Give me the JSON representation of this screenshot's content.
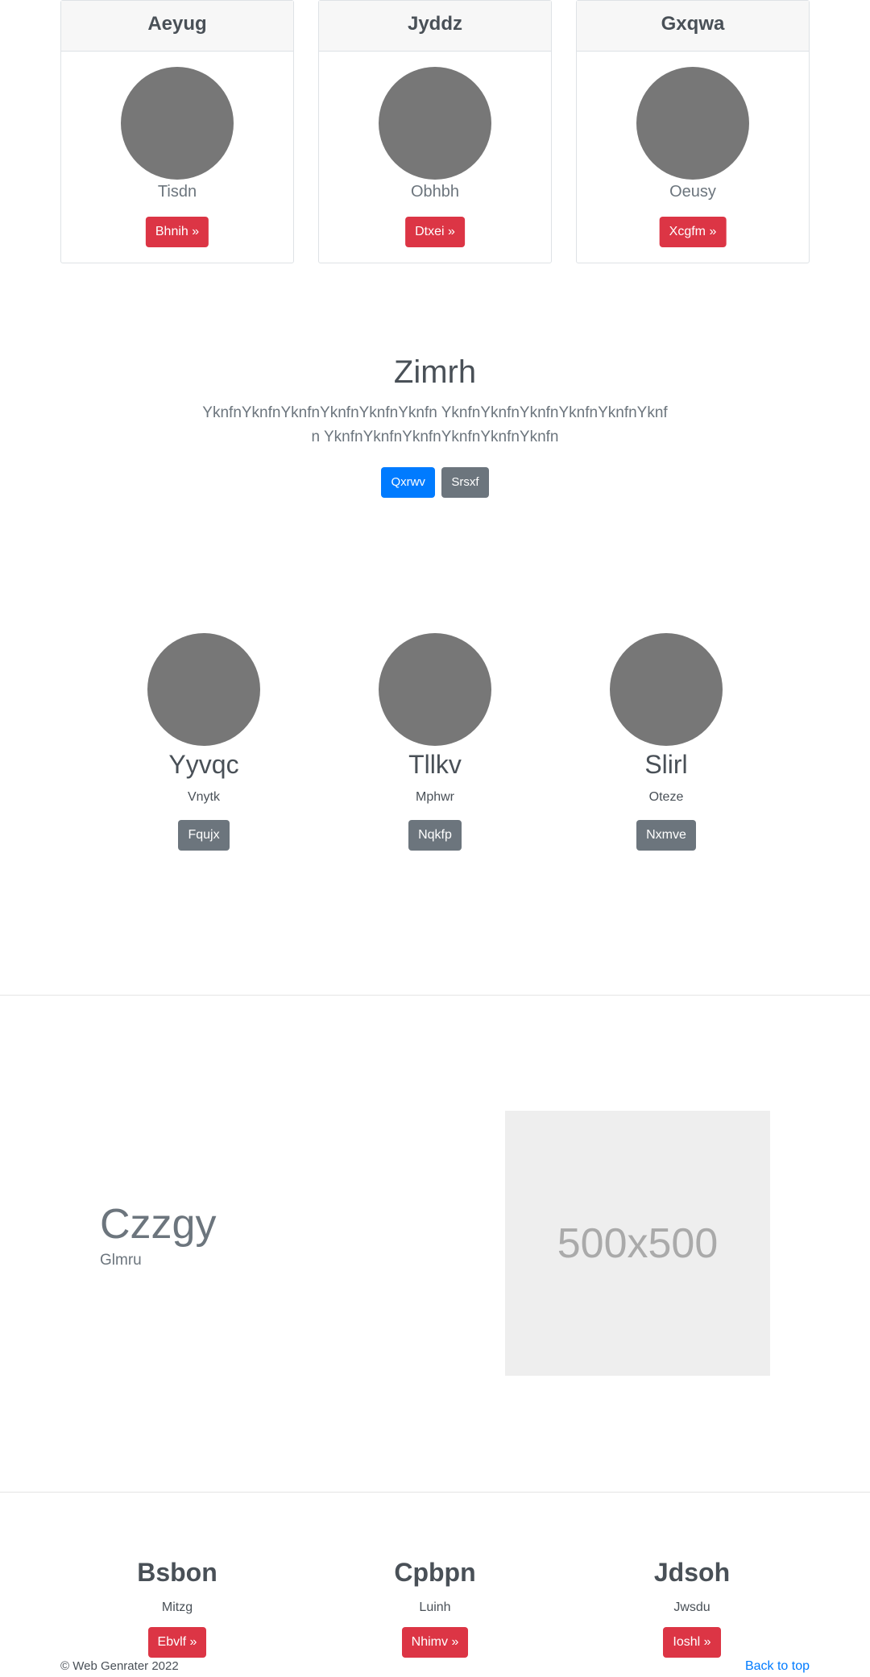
{
  "cards": [
    {
      "title": "Aeyug",
      "subtitle": "Tisdn",
      "button": "Bhnih »"
    },
    {
      "title": "Jyddz",
      "subtitle": "Obhbh",
      "button": "Dtxei »"
    },
    {
      "title": "Gxqwa",
      "subtitle": "Oeusy",
      "button": "Xcgfm »"
    }
  ],
  "hero": {
    "title": "Zimrh",
    "lead": "YknfnYknfnYknfnYknfnYknfnYknfn YknfnYknfnYknfnYknfnYknfnYknfn YknfnYknfnYknfnYknfnYknfnYknfn",
    "primary_button": "Qxrwv",
    "secondary_button": "Srsxf"
  },
  "people": [
    {
      "name": "Yyvqc",
      "role": "Vnytk",
      "button": "Fqujx"
    },
    {
      "name": "Tllkv",
      "role": "Mphwr",
      "button": "Nqkfp"
    },
    {
      "name": "Slirl",
      "role": "Oteze",
      "button": "Nxmve"
    }
  ],
  "feature": {
    "title": "Czzgy",
    "subtitle": "Glmru",
    "placeholder_text": "500x500"
  },
  "columns": [
    {
      "title": "Bsbon",
      "subtitle": "Mitzg",
      "button": "Ebvlf »"
    },
    {
      "title": "Cpbpn",
      "subtitle": "Luinh",
      "button": "Nhimv »"
    },
    {
      "title": "Jdsoh",
      "subtitle": "Jwsdu",
      "button": "Ioshl »"
    }
  ],
  "footer": {
    "copyright": "© Web Genrater 2022",
    "back_to_top": "Back to top"
  }
}
